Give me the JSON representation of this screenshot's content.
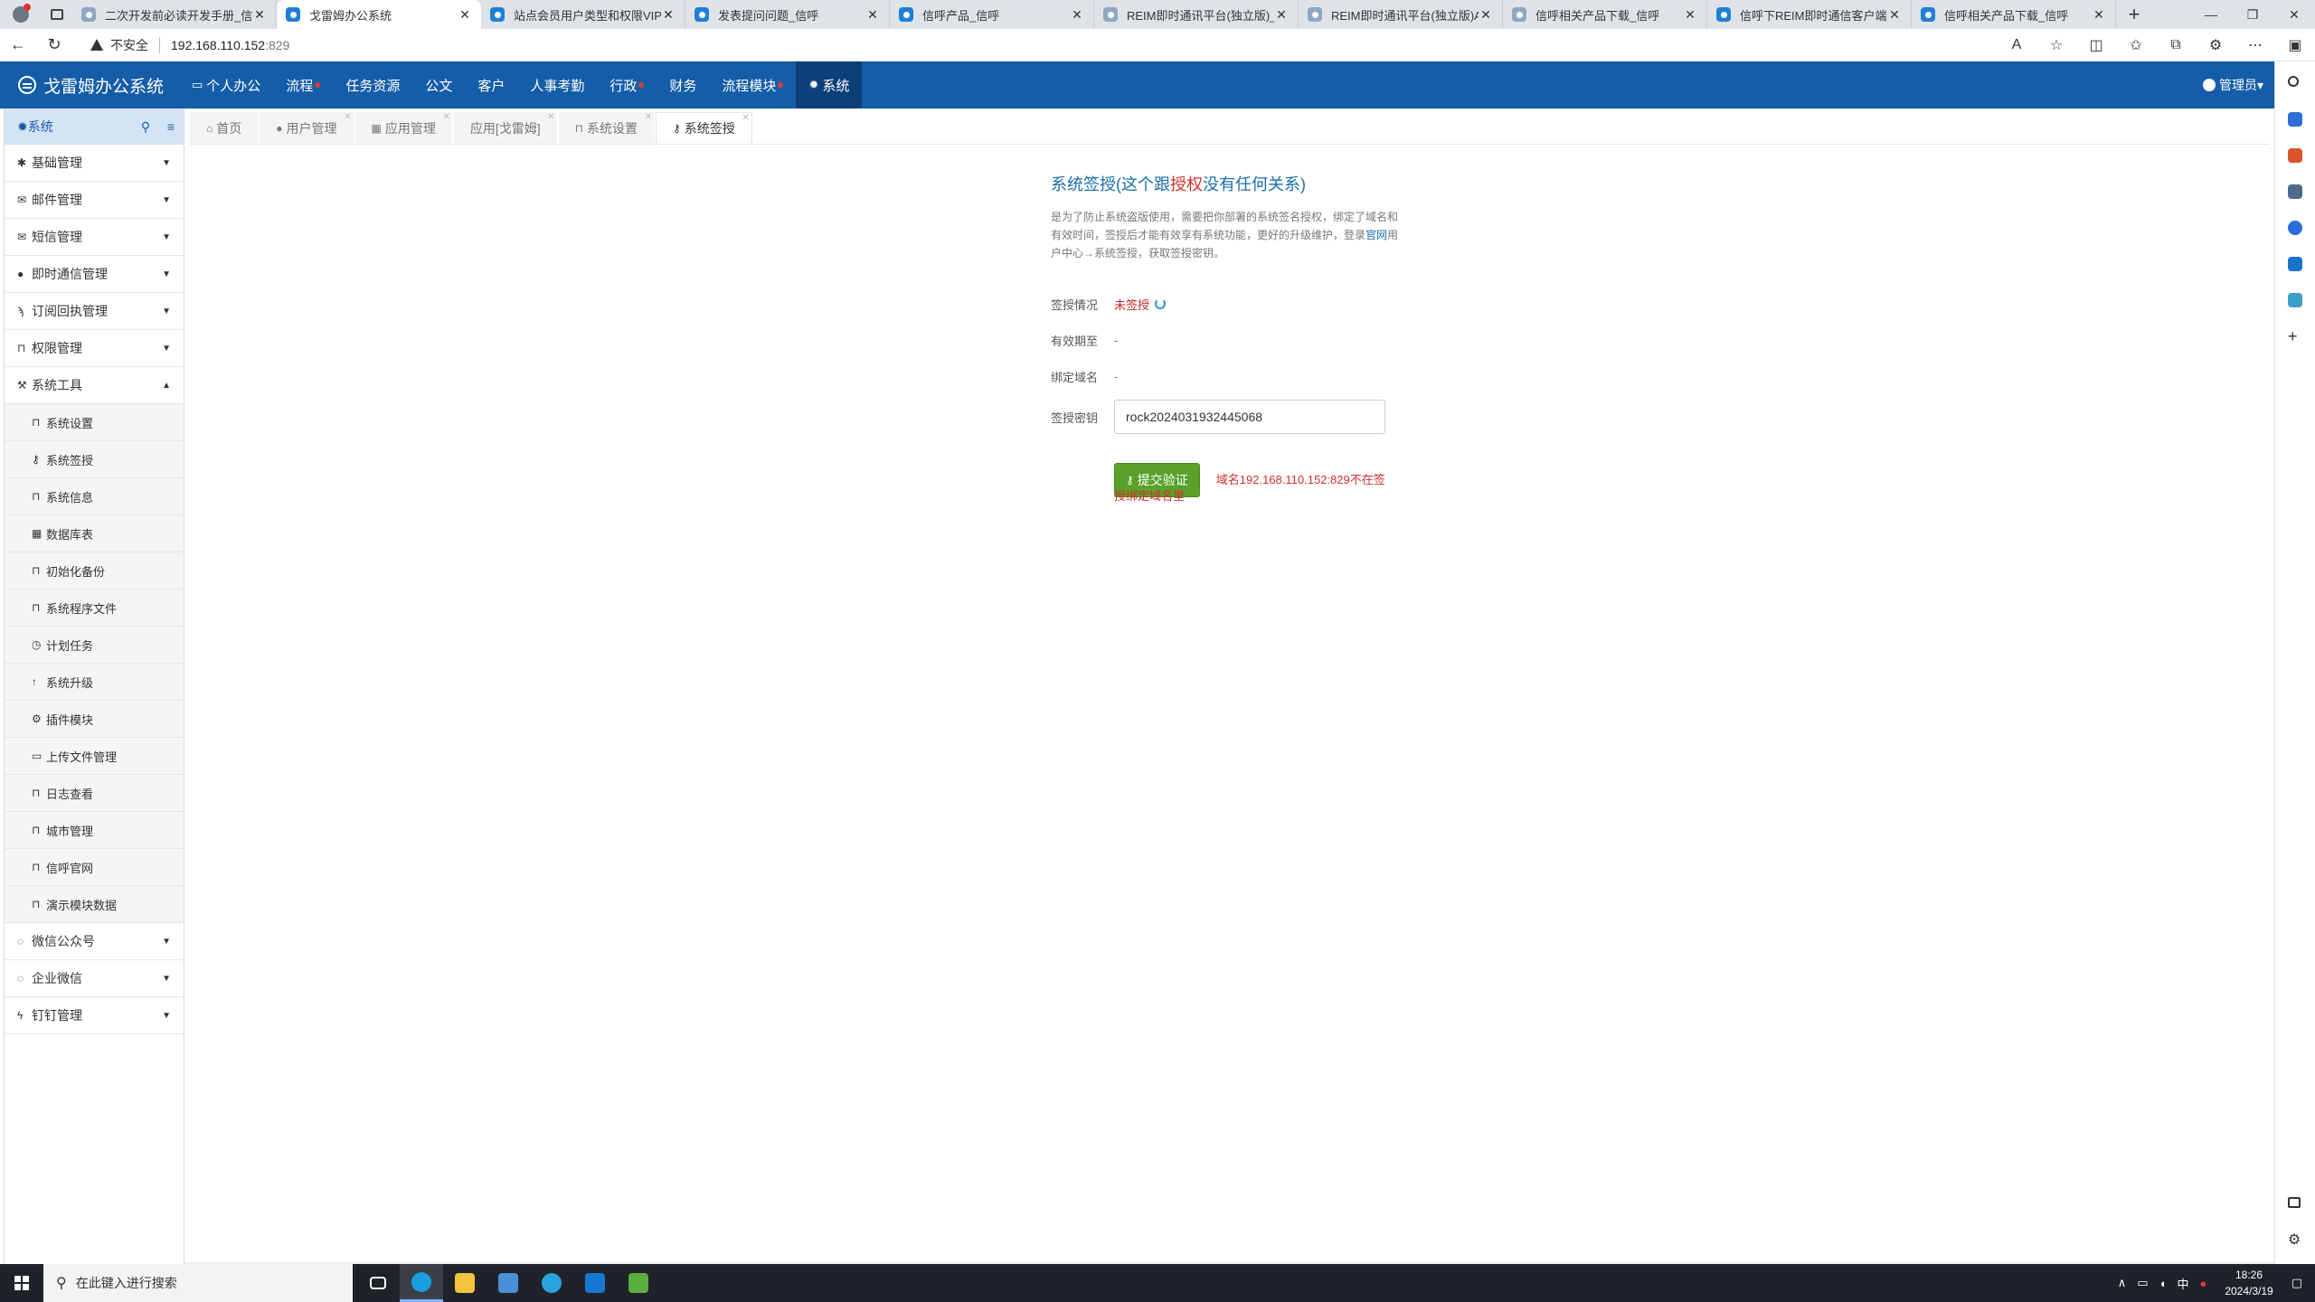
{
  "browser": {
    "tabs": [
      {
        "title": "二次开发前必读开发手册_信呼",
        "active": false
      },
      {
        "title": "戈雷姆办公系统",
        "active": true
      },
      {
        "title": "站点会员用户类型和权限VIP说明",
        "active": false
      },
      {
        "title": "发表提问问题_信呼",
        "active": false
      },
      {
        "title": "信呼产品_信呼",
        "active": false
      },
      {
        "title": "REIM即时通讯平台(独立版)_信",
        "active": false
      },
      {
        "title": "REIM即时通讯平台(独立版)API",
        "active": false
      },
      {
        "title": "信呼相关产品下载_信呼",
        "active": false
      },
      {
        "title": "信呼下REIM即时通信客户端(",
        "active": false
      },
      {
        "title": "信呼相关产品下载_信呼",
        "active": false
      }
    ],
    "insecure_label": "不安全",
    "url_host": "192.168.110.152",
    "url_port": ":829"
  },
  "app": {
    "brand": "戈雷姆办公系统",
    "nav": [
      {
        "label": "个人办公",
        "icon": "monitor-icon",
        "dot": false,
        "active": false
      },
      {
        "label": "流程",
        "icon": "",
        "dot": true,
        "active": false
      },
      {
        "label": "任务资源",
        "icon": "",
        "dot": false,
        "active": false
      },
      {
        "label": "公文",
        "icon": "",
        "dot": false,
        "active": false
      },
      {
        "label": "客户",
        "icon": "",
        "dot": false,
        "active": false
      },
      {
        "label": "人事考勤",
        "icon": "",
        "dot": false,
        "active": false
      },
      {
        "label": "行政",
        "icon": "",
        "dot": true,
        "active": false
      },
      {
        "label": "财务",
        "icon": "",
        "dot": false,
        "active": false
      },
      {
        "label": "流程模块",
        "icon": "",
        "dot": true,
        "active": false
      },
      {
        "label": "系统",
        "icon": "gear-icon",
        "dot": false,
        "active": true
      }
    ],
    "user": "管理员"
  },
  "sidebar": {
    "title": "系统",
    "groups": [
      {
        "label": "基础管理",
        "icon": "asterisk-icon",
        "expanded": false
      },
      {
        "label": "邮件管理",
        "icon": "envelope-icon",
        "expanded": false
      },
      {
        "label": "短信管理",
        "icon": "envelope-open-icon",
        "expanded": false
      },
      {
        "label": "即时通信管理",
        "icon": "comment-icon",
        "expanded": false
      },
      {
        "label": "订阅回执管理",
        "icon": "rss-icon",
        "expanded": false
      },
      {
        "label": "权限管理",
        "icon": "bookmark-icon",
        "expanded": false
      },
      {
        "label": "系统工具",
        "icon": "wrench-icon",
        "expanded": true
      }
    ],
    "sub_items": [
      {
        "label": "系统设置",
        "icon": "bookmark-icon"
      },
      {
        "label": "系统签授",
        "icon": "key-icon"
      },
      {
        "label": "系统信息",
        "icon": "bookmark-icon"
      },
      {
        "label": "数据库表",
        "icon": "table-icon"
      },
      {
        "label": "初始化备份",
        "icon": "bookmark-icon"
      },
      {
        "label": "系统程序文件",
        "icon": "bookmark-icon"
      },
      {
        "label": "计划任务",
        "icon": "clock-icon"
      },
      {
        "label": "系统升级",
        "icon": "arrow-up-icon"
      },
      {
        "label": "插件模块",
        "icon": "cogs-icon"
      },
      {
        "label": "上传文件管理",
        "icon": "folder-icon"
      },
      {
        "label": "日志查看",
        "icon": "bookmark-icon"
      },
      {
        "label": "城市管理",
        "icon": "bookmark-icon"
      },
      {
        "label": "信呼官网",
        "icon": "bookmark-icon"
      },
      {
        "label": "演示模块数据",
        "icon": "bookmark-icon"
      }
    ],
    "bottom_groups": [
      {
        "label": "微信公众号",
        "icon": "comments-icon"
      },
      {
        "label": "企业微信",
        "icon": "comments-icon"
      },
      {
        "label": "钉钉管理",
        "icon": "bolt-icon"
      }
    ]
  },
  "content_tabs": [
    {
      "label": "首页",
      "icon": "home-icon",
      "active": false
    },
    {
      "label": "用户管理",
      "icon": "user-icon",
      "active": false
    },
    {
      "label": "应用管理",
      "icon": "grid-icon",
      "active": false
    },
    {
      "label": "应用[戈雷姆]",
      "icon": "",
      "active": false
    },
    {
      "label": "系统设置",
      "icon": "bookmark-icon",
      "active": false
    },
    {
      "label": "系统签授",
      "icon": "key-icon",
      "active": true
    }
  ],
  "panel": {
    "title_pre": "系统签授(这个跟",
    "title_hl": "授权",
    "title_post": "没有任何关系)",
    "desc_1": "是为了防止系统盗版使用，需要把你部署的系统签名授权，绑定了域名和有效时间，签授后才能有效享有系统功能，更好的升级维护，登录",
    "desc_link": "官网",
    "desc_2": "用户中心→系统签授，获取签授密钥。",
    "status_label": "签授情况",
    "status_value": "未签授",
    "expire_label": "有效期至",
    "expire_value": "-",
    "domain_label": "绑定域名",
    "domain_value": "-",
    "key_label": "签授密钥",
    "key_value": "rock2024031932445068",
    "submit_label": "提交验证",
    "error_1": "域名192.168.110.152:829不在签",
    "error_2": "授绑定域名里"
  },
  "taskbar": {
    "search_placeholder": "在此键入进行搜索",
    "ime": "中",
    "time": "18:26",
    "date": "2024/3/19"
  }
}
